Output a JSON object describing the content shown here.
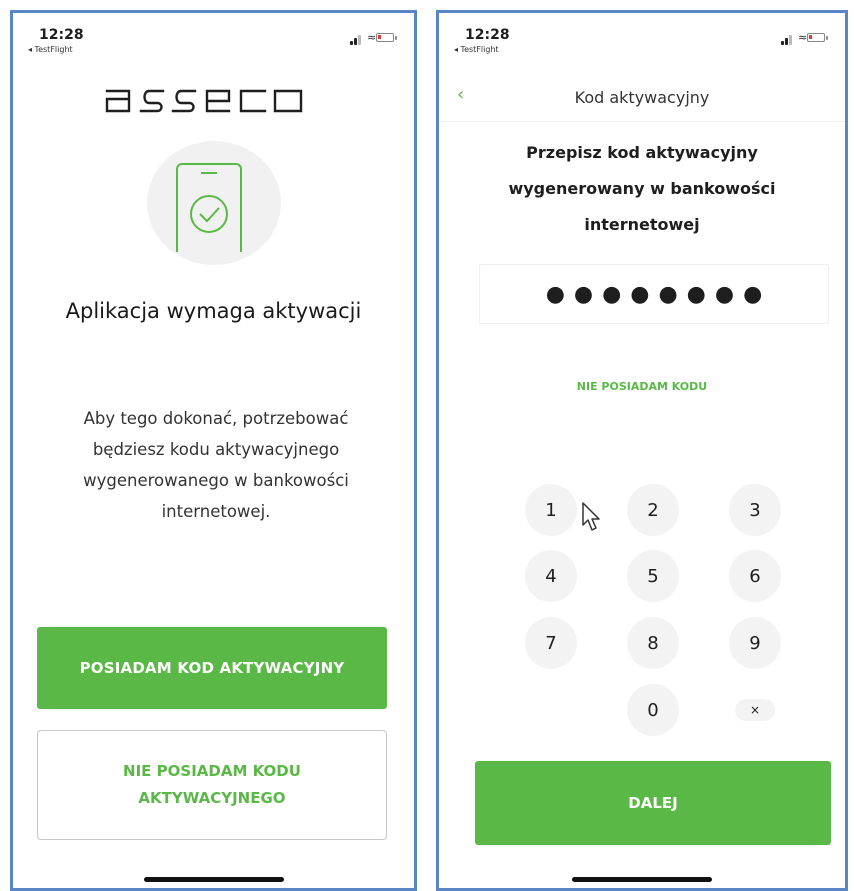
{
  "status_bar": {
    "time": "12:28",
    "back_app": "◂ TestFlight"
  },
  "left_screen": {
    "logo_text": "asseco",
    "headline": "Aplikacja wymaga aktywacji",
    "description": "Aby tego dokonać, potrzebować będziesz kodu aktywacyjnego wygenerowanego w bankowości internetowej.",
    "primary_button": "POSIADAM KOD AKTYWACYJNY",
    "secondary_button_line1": "NIE POSIADAM KODU",
    "secondary_button_line2": "AKTYWACYJNEGO"
  },
  "right_screen": {
    "back_icon": "chevron-left-icon",
    "nav_title": "Kod aktywacyjny",
    "instruction_line1": "Przepisz kod aktywacyjny",
    "instruction_line2": "wygenerowany w bankowości",
    "instruction_line3": "internetowej",
    "code_mask": "●●●●●●●●",
    "no_code_link": "NIE POSIADAM KODU",
    "keypad": {
      "k1": "1",
      "k2": "2",
      "k3": "3",
      "k4": "4",
      "k5": "5",
      "k6": "6",
      "k7": "7",
      "k8": "8",
      "k9": "9",
      "k0": "0",
      "clear": "×"
    },
    "submit_button": "DALEJ"
  },
  "colors": {
    "accent_green": "#5ab946",
    "frame_blue": "#5b86c5",
    "battery_low": "#e53935"
  }
}
